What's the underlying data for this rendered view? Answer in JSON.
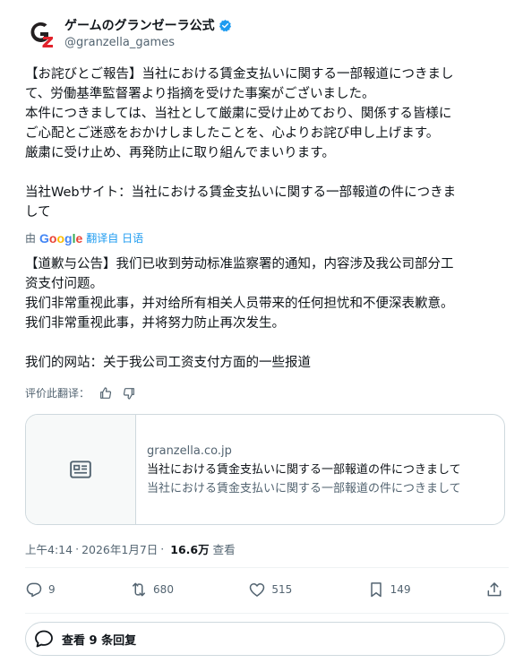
{
  "account": {
    "display_name": "ゲームのグランゼーラ公式",
    "handle": "@granzella_games"
  },
  "tweet": {
    "lines": [
      "【お詫びとご報告】当社における賃金支払いに関する一部報道につきまし",
      "て、労働基準監督署より指摘を受けた事案がございました。",
      "本件につきましては、当社として厳粛に受け止めており、関係する皆様に",
      "ご心配とご迷惑をおかけしましたことを、心よりお詫び申し上げます。",
      "厳粛に受け止め、再発防止に取り組んでまいります。",
      "当社Webサイト：当社における賃金支払いに関する一部報道の件につきま",
      "して"
    ]
  },
  "translation": {
    "prefix": "由",
    "google": "Google",
    "link": "翻译自 日语",
    "lines": [
      "【道歉与公告】我们已收到劳动标准监察署的通知，内容涉及我公司部分工",
      "资支付问题。",
      "我们非常重视此事，并对给所有相关人员带来的任何担忧和不便深表歉意。",
      "我们非常重视此事，并将努力防止再次发生。",
      "我们的网站：关于我公司工资支付方面的一些报道"
    ],
    "rate_label": "评价此翻译："
  },
  "card": {
    "domain": "granzella.co.jp",
    "title": "当社における賃金支払いに関する一部報道の件につきまして",
    "description": "当社における賃金支払いに関する一部報道の件につきまして"
  },
  "meta": {
    "time": "上午4:14",
    "sep": "·",
    "date": "2026年1月7日",
    "sep2": "·",
    "views": "16.6万",
    "views_label": "查看"
  },
  "actions": {
    "replies": "9",
    "reposts": "680",
    "likes": "515",
    "bookmarks": "149"
  },
  "replies_button": "查看 9 条回复",
  "colors": {
    "accent": "#1d9bf0",
    "muted": "#536471",
    "text": "#0f1419",
    "border": "#cfd9de",
    "logo_red": "#e2222b",
    "logo_dark": "#231f20"
  },
  "icons": [
    "granzella-logo",
    "verified-badge-icon",
    "thumbs-up-icon",
    "thumbs-down-icon",
    "article-icon",
    "reply-icon",
    "repost-icon",
    "like-icon",
    "bookmark-icon",
    "share-icon",
    "replies-bubble-icon"
  ]
}
